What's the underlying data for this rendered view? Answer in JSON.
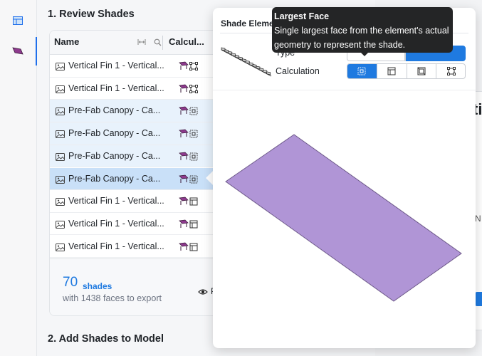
{
  "sections": {
    "review_title": "1. Review Shades",
    "add_title": "2. Add Shades to Model"
  },
  "table": {
    "col_name": "Name",
    "col_calc": "Calcul...",
    "rows": [
      {
        "name": "Vertical Fin 1 - Vertical...",
        "state": "normal",
        "calc": "bounding-box"
      },
      {
        "name": "Vertical Fin 1 - Vertical...",
        "state": "normal",
        "calc": "bounding-box"
      },
      {
        "name": "Pre-Fab Canopy - Ca...",
        "state": "highlight",
        "calc": "largest-face"
      },
      {
        "name": "Pre-Fab Canopy - Ca...",
        "state": "highlight",
        "calc": "largest-face"
      },
      {
        "name": "Pre-Fab Canopy - Ca...",
        "state": "highlight",
        "calc": "largest-face"
      },
      {
        "name": "Pre-Fab Canopy - Ca...",
        "state": "selected",
        "calc": "largest-face"
      },
      {
        "name": "Vertical Fin 1 - Vertical...",
        "state": "normal",
        "calc": "side-face"
      },
      {
        "name": "Vertical Fin 1 - Vertical...",
        "state": "normal",
        "calc": "side-face"
      },
      {
        "name": "Vertical Fin 1 - Vertical...",
        "state": "normal",
        "calc": "side-face"
      }
    ]
  },
  "summary": {
    "count": "70",
    "unit": "shades",
    "detail": "with 1438 faces to export",
    "preview_label": "P"
  },
  "popover": {
    "title": "Shade Element Calculation",
    "type_label": "Type",
    "calc_label": "Calculation",
    "calc_options": [
      {
        "icon": "largest-face-icon",
        "active": true
      },
      {
        "icon": "side-face-icon",
        "active": false
      },
      {
        "icon": "full-geometry-icon",
        "active": false
      },
      {
        "icon": "bounding-box-icon",
        "active": false
      }
    ]
  },
  "tooltip": {
    "title": "Largest Face",
    "body": "Single largest face from the element's actual geometry to represent the shade."
  },
  "background": {
    "partial_heading": "ti",
    "partial_text": "N"
  },
  "colors": {
    "accent": "#1f7ae0",
    "row_highlight": "#e8f2fc",
    "row_selected": "#c9e0f8",
    "shade_face": "#b095d6",
    "tooltip_bg": "#242526"
  }
}
